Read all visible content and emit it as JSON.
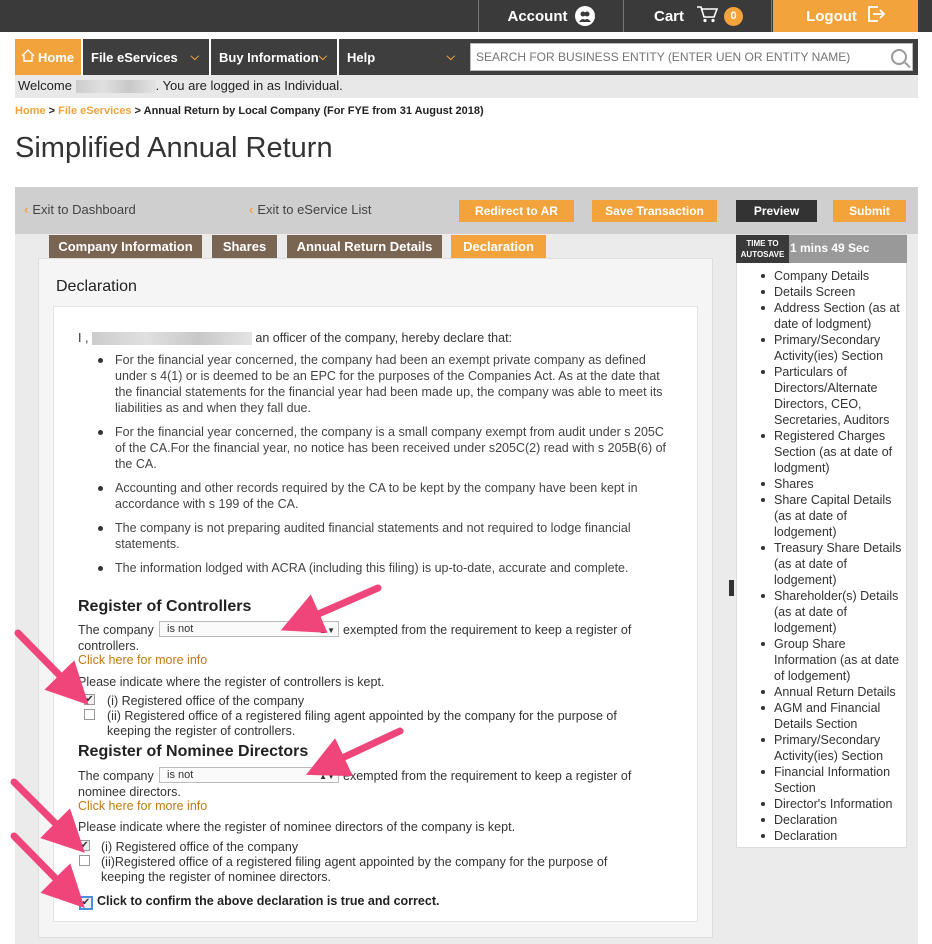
{
  "topbar": {
    "account": "Account",
    "cart": "Cart",
    "cart_count": "0",
    "logout": "Logout"
  },
  "nav": {
    "home": "Home",
    "file_eservices": "File eServices",
    "buy_information": "Buy Information",
    "help": "Help",
    "search_placeholder": "SEARCH FOR BUSINESS ENTITY (ENTER UEN OR ENTITY NAME)"
  },
  "welcome": {
    "prefix": "Welcome",
    "suffix": ". You are logged in as Individual."
  },
  "breadcrumb": {
    "home": "Home",
    "sep": " > ",
    "file": "File eServices",
    "current": " > Annual Return by Local Company (For FYE from 31 August 2018)"
  },
  "page_title": "Simplified Annual Return",
  "actions": {
    "exit_dashboard": "Exit to Dashboard",
    "exit_list": "Exit to eService List",
    "redirect": "Redirect to AR",
    "save": "Save Transaction",
    "preview": "Preview",
    "submit": "Submit"
  },
  "tabs": [
    "Company Information",
    "Shares",
    "Annual Return Details",
    "Declaration"
  ],
  "declaration": {
    "heading": "Declaration",
    "intro_prefix": "I ,",
    "intro_suffix": "an officer of the company, hereby declare that:",
    "items": [
      "For the financial year concerned, the company had been an exempt private company as defined under s 4(1) or is deemed to be an EPC for the purposes of the Companies Act. As at the date that the financial statements for the financial year had been made up, the company was able to meet its liabilities as and when they fall due.",
      "For the financial year concerned, the company is a small company exempt from audit under s 205C of the CA.For the financial year, no notice has been received under s205C(2) read with s 205B(6) of the CA.",
      "Accounting and other records required by the CA to be kept by the company have been kept in accordance with s 199 of the CA.",
      "The company is not preparing audited financial statements and not required to lodge financial statements.",
      "The information lodged with ACRA (including this filing) is up-to-date, accurate and complete."
    ]
  },
  "controllers": {
    "heading": "Register of Controllers",
    "the_company": "The company",
    "select_value": "is not",
    "exempted": "exempted from the requirement to keep a register of",
    "wrap": "controllers.",
    "more_info": "Click here for more info",
    "indicate": "Please indicate where the register of controllers is kept.",
    "opt1": "(i) Registered office of the company",
    "opt2a": "(ii) Registered office of a registered filing agent appointed by the company for the purpose of",
    "opt2b": "keeping the register of controllers."
  },
  "nominee": {
    "heading": "Register of Nominee Directors",
    "the_company": "The company",
    "select_value": "is not",
    "exempted": "exempted from the requirement to keep a register of",
    "wrap": "nominee directors.",
    "more_info": "Click here for more info",
    "indicate": "Please indicate where the register of nominee directors of the company is kept.",
    "opt1": "(i) Registered office of the company",
    "opt2a": "(ii)Registered office of a registered filing agent appointed by the company for the purpose of",
    "opt2b": "keeping the register of nominee directors."
  },
  "confirm": "Click to confirm the above declaration is true and correct.",
  "autosave": {
    "label": "TIME TO AUTOSAVE",
    "time": "1 mins  49 Sec"
  },
  "side_items": [
    "Company Details",
    "Details Screen",
    "Address Section (as at date of lodgment)",
    "Primary/Secondary Activity(ies) Section",
    "Particulars of Directors/Alternate Directors, CEO, Secretaries, Auditors",
    "Registered Charges Section (as at date of lodgment)",
    "Shares",
    "Share Capital Details (as at date of lodgement)",
    "Treasury Share Details (as at date of lodgement)",
    "Shareholder(s) Details (as at date of lodgement)",
    "Group Share Information (as at date of lodgement)",
    "Annual Return Details",
    "AGM and Financial Details Section",
    "Primary/Secondary Activity(ies) Section",
    "Financial Information Section",
    "Director's Information",
    "Declaration",
    "Declaration"
  ],
  "colors": {
    "accent": "#f3a33b",
    "dark": "#3a3a3a",
    "tab": "#7a6553",
    "annotation": "#f0457a"
  }
}
